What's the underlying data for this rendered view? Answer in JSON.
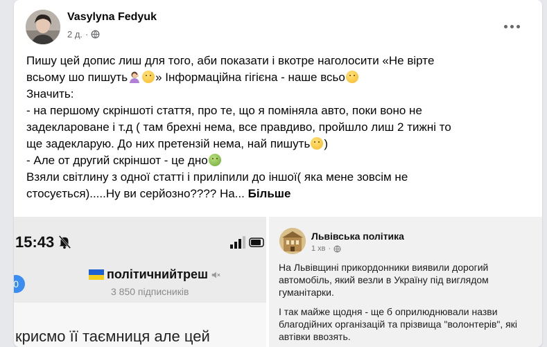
{
  "post": {
    "author": "Vasylyna Fedyuk",
    "time": "2 д.",
    "privacy_icon": "globe-icon",
    "text_lines": [
      "Пишу цей допис лиш для того, аби показати  і вкотре наголосити «Не віртe",
      "всьому шо пишуть",
      "» Інформаційна гігієна - наше всьо",
      "Значить:",
      "- на першому скріншоті стаття, про те, що я поміняла авто, поки воно не",
      "задекларoване і т.д ( там брехні нема, все правдиво, пройшло лиш 2 тижні то",
      "ще задекларую. До них претензій нема, най пишуть",
      ")",
      "- Але от другий скріншот - це дно",
      "Взяли світлину з одної статті і приліпили до іншої( яка мене зовсім не",
      "стосується).....Ну ви серйозно???? На..."
    ],
    "see_more": "Більше"
  },
  "left_screenshot": {
    "time": "15:43",
    "badge": "0",
    "channel_name": "політичнийтреш",
    "subscribers": "3 850 підписників",
    "bottom_text": "крисмо її таємниця  але цей"
  },
  "right_screenshot": {
    "page_name": "Львівська політика",
    "time": "1 хв",
    "paragraphs": [
      "На Львівщині прикордонники виявили дорогий автомобіль, який везли в Україну під виглядом гуманітарки.",
      "І так майже щодня - ще б оприлюднювали назви благодійних організацій та прізвища \"волонтерів\", які автівки ввозять."
    ]
  },
  "colors": {
    "card_bg": "#ffffff",
    "page_bg": "#e6e8ec",
    "secondary_text": "#65676b",
    "badge_blue": "#3b8ef0"
  }
}
